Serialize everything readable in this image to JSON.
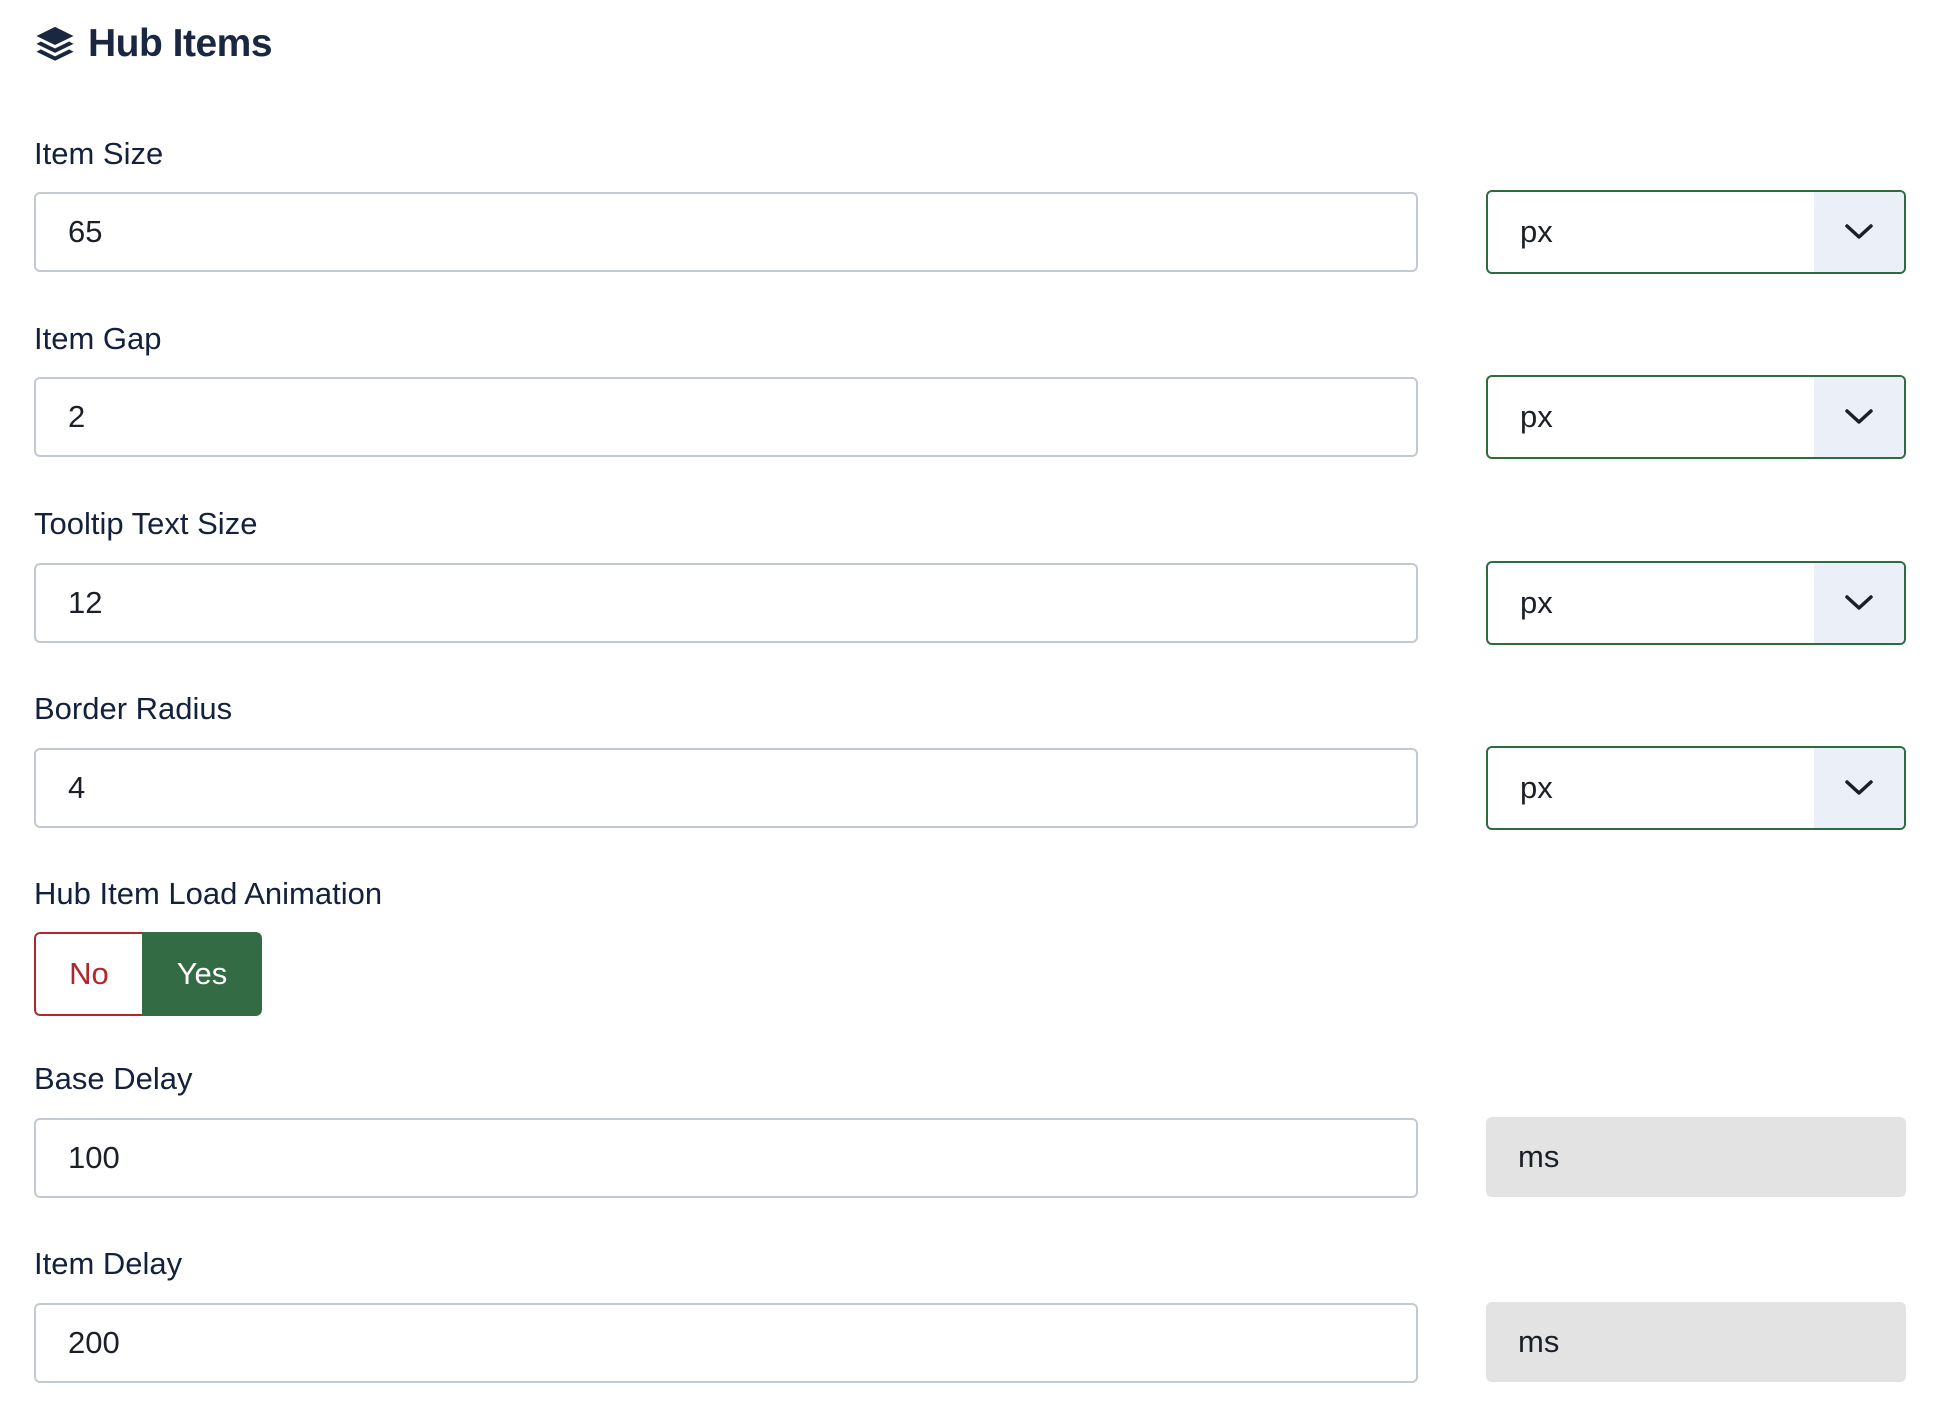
{
  "header": {
    "icon": "layers-icon",
    "title": "Hub Items"
  },
  "fields": {
    "item_size": {
      "label": "Item Size",
      "value": "65",
      "unit": "px"
    },
    "item_gap": {
      "label": "Item Gap",
      "value": "2",
      "unit": "px"
    },
    "tooltip_text_size": {
      "label": "Tooltip Text Size",
      "value": "12",
      "unit": "px"
    },
    "border_radius": {
      "label": "Border Radius",
      "value": "4",
      "unit": "px"
    },
    "load_animation": {
      "label": "Hub Item Load Animation",
      "options": [
        "No",
        "Yes"
      ],
      "selected": "Yes"
    },
    "base_delay": {
      "label": "Base Delay",
      "value": "100",
      "unit": "ms"
    },
    "item_delay": {
      "label": "Item Delay",
      "value": "200",
      "unit": "ms"
    }
  },
  "colors": {
    "heading": "#1a2740",
    "label": "#14213d",
    "select_border": "#2e6b3f",
    "select_arrow_bg": "#eaeff8",
    "toggle_no": "#b0262c",
    "toggle_yes_bg": "#336b44",
    "addon_bg": "#e3e3e3",
    "input_border": "#c3c9d3"
  }
}
